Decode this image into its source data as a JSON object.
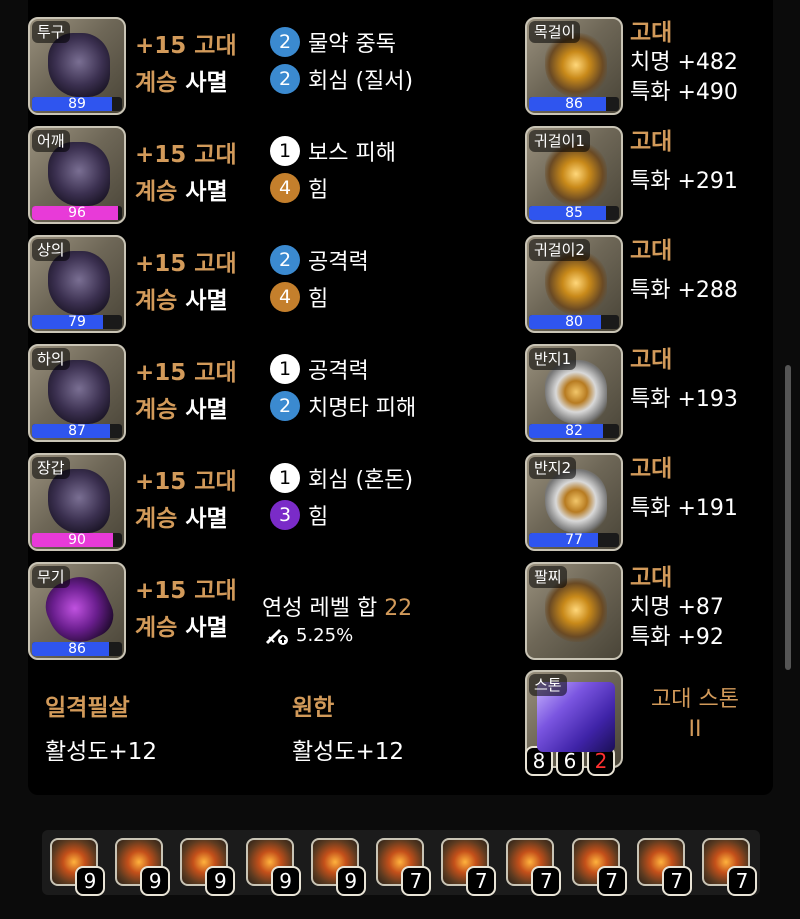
{
  "armor": [
    {
      "slot_label": "투구",
      "quality": "89",
      "quality_pct": 89,
      "quality_color": "#2f55ef",
      "grade": "+15 고대",
      "succession": "계승",
      "set": "사멸",
      "effects": [
        {
          "level": "2",
          "name": "물약 중독",
          "color": "#3b8ad0"
        },
        {
          "level": "2",
          "name": "회심 (질서)",
          "color": "#3b8ad0"
        }
      ]
    },
    {
      "slot_label": "어깨",
      "quality": "96",
      "quality_pct": 96,
      "quality_color": "#e83ad8",
      "grade": "+15 고대",
      "succession": "계승",
      "set": "사멸",
      "effects": [
        {
          "level": "1",
          "name": "보스 피해",
          "color": "#ffffff"
        },
        {
          "level": "4",
          "name": "힘",
          "color": "#c47f2c"
        }
      ]
    },
    {
      "slot_label": "상의",
      "quality": "79",
      "quality_pct": 79,
      "quality_color": "#2f55ef",
      "grade": "+15 고대",
      "succession": "계승",
      "set": "사멸",
      "effects": [
        {
          "level": "2",
          "name": "공격력",
          "color": "#3b8ad0"
        },
        {
          "level": "4",
          "name": "힘",
          "color": "#c47f2c"
        }
      ]
    },
    {
      "slot_label": "하의",
      "quality": "87",
      "quality_pct": 87,
      "quality_color": "#2f55ef",
      "grade": "+15 고대",
      "succession": "계승",
      "set": "사멸",
      "effects": [
        {
          "level": "1",
          "name": "공격력",
          "color": "#ffffff"
        },
        {
          "level": "2",
          "name": "치명타 피해",
          "color": "#3b8ad0"
        }
      ]
    },
    {
      "slot_label": "장갑",
      "quality": "90",
      "quality_pct": 90,
      "quality_color": "#e83ad8",
      "grade": "+15 고대",
      "succession": "계승",
      "set": "사멸",
      "effects": [
        {
          "level": "1",
          "name": "회심 (혼돈)",
          "color": "#ffffff"
        },
        {
          "level": "3",
          "name": "힘",
          "color": "#7a2bc8"
        }
      ]
    },
    {
      "slot_label": "무기",
      "quality": "86",
      "quality_pct": 86,
      "quality_color": "#2f55ef",
      "grade": "+15 고대",
      "succession": "계승",
      "set": "사멸"
    }
  ],
  "refinement": {
    "label": "연성 레벨 합",
    "value": "22",
    "bonus": "5.25%",
    "icon": "sword-up-icon"
  },
  "accessories": [
    {
      "slot_label": "목걸이",
      "quality": "86",
      "quality_pct": 86,
      "grade": "고대",
      "stats": [
        "치명 +482",
        "특화 +490"
      ]
    },
    {
      "slot_label": "귀걸이1",
      "quality": "85",
      "quality_pct": 85,
      "grade": "고대",
      "stats": [
        "특화 +291"
      ]
    },
    {
      "slot_label": "귀걸이2",
      "quality": "80",
      "quality_pct": 80,
      "grade": "고대",
      "stats": [
        "특화 +288"
      ]
    },
    {
      "slot_label": "반지1",
      "quality": "82",
      "quality_pct": 82,
      "grade": "고대",
      "stats": [
        "특화 +193"
      ]
    },
    {
      "slot_label": "반지2",
      "quality": "77",
      "quality_pct": 77,
      "grade": "고대",
      "stats": [
        "특화 +191"
      ]
    },
    {
      "slot_label": "팔찌",
      "grade": "고대",
      "stats": [
        "치명 +87",
        "특화 +92"
      ]
    }
  ],
  "engravings": [
    {
      "name": "일격필살",
      "value": "활성도+12"
    },
    {
      "name": "원한",
      "value": "활성도+12"
    }
  ],
  "stone": {
    "slot_label": "스톤",
    "name": "고대 스톤",
    "tier": "II",
    "levels": [
      "8",
      "6",
      "2"
    ]
  },
  "gems": [
    "9",
    "9",
    "9",
    "9",
    "9",
    "7",
    "7",
    "7",
    "7",
    "7",
    "7"
  ],
  "colors": {
    "gold": "#d29a5a",
    "blue_quality": "#2f55ef",
    "pink_quality": "#e83ad8"
  }
}
